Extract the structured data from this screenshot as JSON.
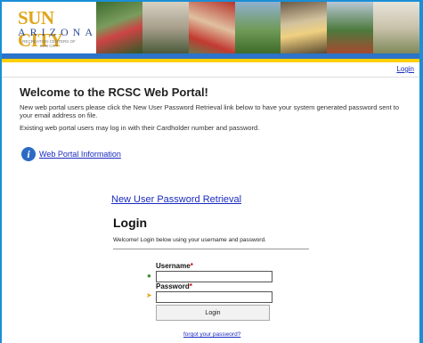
{
  "header": {
    "logo_line1": "SUN CITY",
    "logo_line2": "ARIZONA",
    "logo_line3": "RECREATION CENTERS OF SUN CITY"
  },
  "nav": {
    "login_label": "Login"
  },
  "main": {
    "title": "Welcome to the RCSC Web Portal!",
    "para1": "New web portal users please click the New User Password Retrieval link below to have your system generated password sent to your email address on file.",
    "para2": "Existing web portal users may log in with their Cardholder number and password.",
    "info_link": "Web Portal Information",
    "retrieval_link": "New User Password Retrieval"
  },
  "login": {
    "title": "Login",
    "description": "Welcome! Login below using your username and password.",
    "username_label": "Username",
    "password_label": "Password",
    "required_mark": "*",
    "username_value": "",
    "password_value": "",
    "button_label": "Login",
    "forgot_label": "forgot your password?"
  },
  "colors": {
    "accent_blue": "#2b74c9",
    "accent_yellow": "#ffd000",
    "link": "#1a2bc0"
  }
}
